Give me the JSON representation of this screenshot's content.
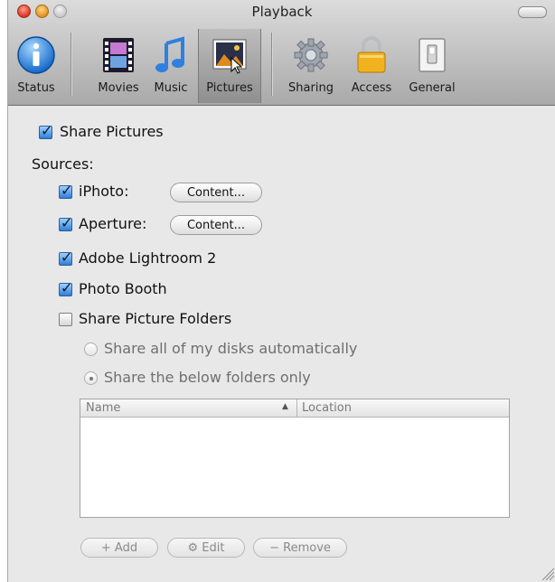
{
  "window": {
    "title": "Playback"
  },
  "toolbar": {
    "items": [
      {
        "label": "Status",
        "icon": "info-icon"
      },
      {
        "label": "Movies",
        "icon": "film-icon"
      },
      {
        "label": "Music",
        "icon": "music-note-icon"
      },
      {
        "label": "Pictures",
        "icon": "picture-icon",
        "selected": true
      },
      {
        "label": "Sharing",
        "icon": "gear-icon"
      },
      {
        "label": "Access",
        "icon": "padlock-icon"
      },
      {
        "label": "General",
        "icon": "light-switch-icon"
      }
    ]
  },
  "pictures": {
    "share_pictures": {
      "label": "Share Pictures",
      "checked": true
    },
    "sources_label": "Sources:",
    "sources": [
      {
        "label": "iPhoto:",
        "checked": true,
        "button": "Content..."
      },
      {
        "label": "Aperture:",
        "checked": true,
        "button": "Content..."
      },
      {
        "label": "Adobe Lightroom 2",
        "checked": true
      },
      {
        "label": "Photo Booth",
        "checked": true
      }
    ],
    "share_folders": {
      "label": "Share Picture Folders",
      "checked": false
    },
    "radio_options": [
      {
        "label": "Share all of my disks automatically",
        "selected": false
      },
      {
        "label": "Share the below folders only",
        "selected": true
      }
    ],
    "table": {
      "columns": [
        "Name",
        "Location"
      ],
      "sort_indicator": "▲",
      "rows": []
    },
    "buttons": {
      "add": "+ Add",
      "edit": "⚙ Edit",
      "remove": "− Remove"
    }
  },
  "colors": {
    "accent": "#2f7ed8",
    "window_bg": "#e8e8e8",
    "toolbar_bottom": "#a9a9a9"
  }
}
